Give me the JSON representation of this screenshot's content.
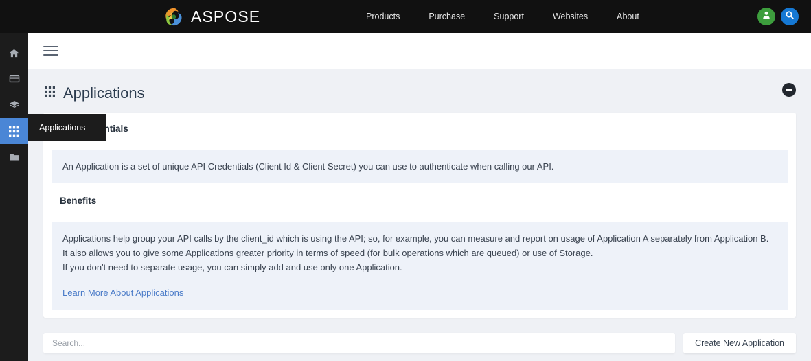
{
  "topbar": {
    "brand": "ASPOSE",
    "logo_icon": "aspose-swirl-logo",
    "nav": [
      {
        "label": "Products"
      },
      {
        "label": "Purchase"
      },
      {
        "label": "Support"
      },
      {
        "label": "Websites"
      },
      {
        "label": "About"
      }
    ],
    "actions": [
      {
        "name": "user-account-button",
        "icon": "user-icon",
        "color": "#3d9e3d"
      },
      {
        "name": "search-button",
        "icon": "search-icon",
        "color": "#1578d3"
      }
    ]
  },
  "sidebar": {
    "items": [
      {
        "label": "Home",
        "icon": "home-icon",
        "active": false
      },
      {
        "label": "Billing",
        "icon": "credit-card-icon",
        "active": false
      },
      {
        "label": "Layers",
        "icon": "layers-icon",
        "active": false
      },
      {
        "label": "Applications",
        "icon": "grid-icon",
        "active": true
      },
      {
        "label": "Files",
        "icon": "folder-icon",
        "active": false
      }
    ],
    "tooltip": "Applications",
    "active_color": "#4a86d6"
  },
  "subheader": {
    "menu_icon": "hamburger-menu-icon"
  },
  "page": {
    "title": "Applications",
    "title_icon": "grid-icon",
    "collapse_icon": "minus-circle-icon",
    "sections": [
      {
        "heading": "API Credentials",
        "body_lines": [
          "An Application is a set of unique API Credentials (Client Id & Client Secret) you can use to authenticate when calling our API."
        ],
        "link": null
      },
      {
        "heading": "Benefits",
        "body_lines": [
          "Applications help group your API calls by the client_id which is using the API; so, for example, you can measure and report on usage of Application A separately from Application B.",
          "It also allows you to give some Applications greater priority in terms of speed (for bulk operations which are queued) or use of Storage.",
          "If you don't need to separate usage, you can simply add and use only one Application."
        ],
        "link": "Learn More About Applications"
      }
    ]
  },
  "toolbar": {
    "search_placeholder": "Search...",
    "search_value": "",
    "create_label": "Create New Application"
  },
  "colors": {
    "topbar_bg": "#111111",
    "rail_bg": "#1c1c1c",
    "accent_blue": "#4a86d6",
    "page_bg": "#eff1f5",
    "panel_bg": "#eef2f9",
    "link": "#4a7bc8"
  }
}
